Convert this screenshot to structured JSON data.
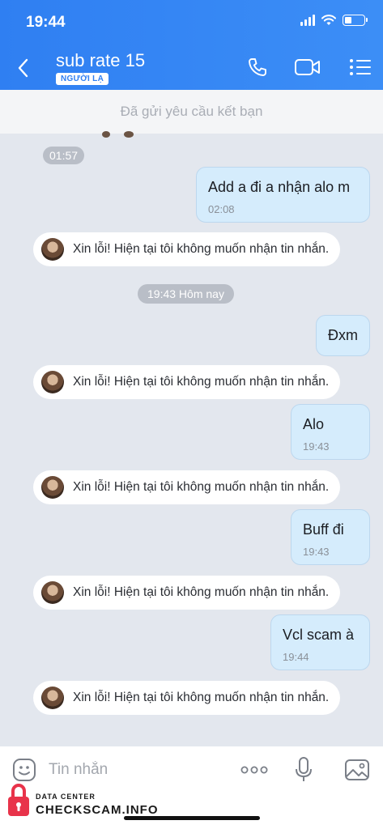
{
  "status_bar": {
    "time": "19:44"
  },
  "header": {
    "title": "sub rate 15",
    "badge": "NGƯỜI LẠ",
    "icons": [
      "back-arrow-icon",
      "phone-icon",
      "video-call-icon",
      "menu-list-icon"
    ]
  },
  "request_bar": {
    "text": "Đã gửi yêu cầu kết bạn"
  },
  "messages": [
    {
      "kind": "time",
      "text": "01:57"
    },
    {
      "kind": "out",
      "text": "Add a đi a nhận alo m",
      "time": "02:08"
    },
    {
      "kind": "notice",
      "text": "Xin lỗi! Hiện tại tôi không muốn nhận tin nhắn."
    },
    {
      "kind": "time",
      "text": "19:43 Hôm nay"
    },
    {
      "kind": "out",
      "text": "Đxm",
      "time": ""
    },
    {
      "kind": "notice",
      "text": "Xin lỗi! Hiện tại tôi không muốn nhận tin nhắn."
    },
    {
      "kind": "out",
      "text": "Alo",
      "time": "19:43"
    },
    {
      "kind": "notice",
      "text": "Xin lỗi! Hiện tại tôi không muốn nhận tin nhắn."
    },
    {
      "kind": "out",
      "text": "Buff đi",
      "time": "19:43"
    },
    {
      "kind": "notice",
      "text": "Xin lỗi! Hiện tại tôi không muốn nhận tin nhắn."
    },
    {
      "kind": "out",
      "text": "Vcl scam à",
      "time": "19:44"
    },
    {
      "kind": "notice",
      "text": "Xin lỗi! Hiện tại tôi không muốn nhận tin nhắn."
    }
  ],
  "input_bar": {
    "placeholder": "Tin nhắn",
    "icons": [
      "emoji-icon",
      "more-icon",
      "microphone-icon",
      "image-icon"
    ]
  },
  "watermark": {
    "top": "DATA CENTER",
    "main": "CHECKSCAM.INFO"
  },
  "colors": {
    "header": "#2f7ff2",
    "bubble_out": "#d5ecfc",
    "chat_bg": "#e3e7ee"
  }
}
